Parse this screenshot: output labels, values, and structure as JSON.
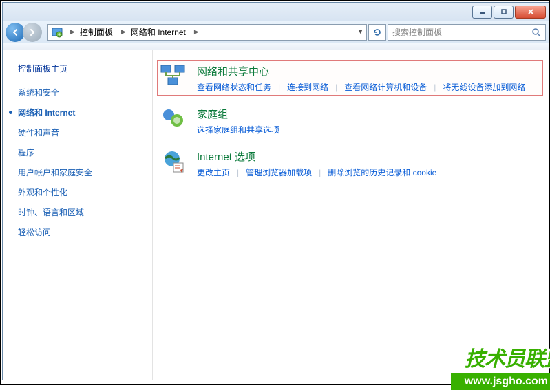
{
  "titlebar": {
    "minimize_name": "minimize-button",
    "maximize_name": "maximize-button",
    "close_name": "close-button"
  },
  "breadcrumb": {
    "segment1": "控制面板",
    "segment2": "网络和 Internet"
  },
  "search": {
    "placeholder": "搜索控制面板"
  },
  "sidebar": {
    "title": "控制面板主页",
    "items": [
      {
        "label": "系统和安全",
        "active": false
      },
      {
        "label": "网络和 Internet",
        "active": true
      },
      {
        "label": "硬件和声音",
        "active": false
      },
      {
        "label": "程序",
        "active": false
      },
      {
        "label": "用户帐户和家庭安全",
        "active": false
      },
      {
        "label": "外观和个性化",
        "active": false
      },
      {
        "label": "时钟、语言和区域",
        "active": false
      },
      {
        "label": "轻松访问",
        "active": false
      }
    ]
  },
  "categories": {
    "network": {
      "title": "网络和共享中心",
      "links": [
        "查看网络状态和任务",
        "连接到网络",
        "查看网络计算机和设备",
        "将无线设备添加到网络"
      ]
    },
    "homegroup": {
      "title": "家庭组",
      "links": [
        "选择家庭组和共享选项"
      ]
    },
    "inet": {
      "title": "Internet 选项",
      "links": [
        "更改主页",
        "管理浏览器加载项",
        "删除浏览的历史记录和 cookie"
      ]
    }
  },
  "watermark": {
    "line1": "技术员联盟",
    "line2": "www.jsgho.com"
  }
}
